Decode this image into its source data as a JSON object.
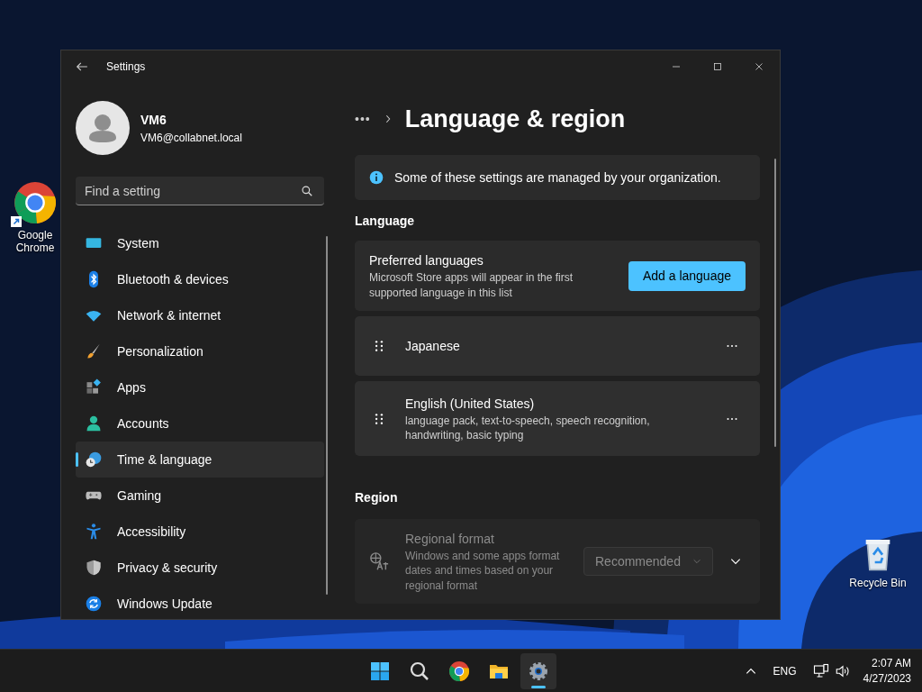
{
  "desktop_icons": [
    {
      "label": "Google Chrome",
      "kind": "chrome"
    },
    {
      "label": "Recycle Bin",
      "kind": "recycle"
    }
  ],
  "window": {
    "title": "Settings",
    "user": {
      "name": "VM6",
      "email": "VM6@collabnet.local"
    },
    "search": {
      "placeholder": "Find a setting"
    },
    "sidebar": {
      "items": [
        {
          "label": "System",
          "selected": false
        },
        {
          "label": "Bluetooth & devices",
          "selected": false
        },
        {
          "label": "Network & internet",
          "selected": false
        },
        {
          "label": "Personalization",
          "selected": false
        },
        {
          "label": "Apps",
          "selected": false
        },
        {
          "label": "Accounts",
          "selected": false
        },
        {
          "label": "Time & language",
          "selected": true
        },
        {
          "label": "Gaming",
          "selected": false
        },
        {
          "label": "Accessibility",
          "selected": false
        },
        {
          "label": "Privacy & security",
          "selected": false
        },
        {
          "label": "Windows Update",
          "selected": false
        }
      ]
    },
    "page": {
      "breadcrumb_more": "•••",
      "title": "Language & region",
      "notice": "Some of these settings are managed by your organization.",
      "language": {
        "heading": "Language",
        "preferred": {
          "title": "Preferred languages",
          "description": "Microsoft Store apps will appear in the first supported language in this list",
          "button": "Add a language"
        },
        "languages": [
          {
            "name": "Japanese"
          },
          {
            "name": "English (United States)",
            "detail": "language pack, text-to-speech, speech recognition, handwriting, basic typing"
          }
        ]
      },
      "region": {
        "heading": "Region",
        "regional_format": {
          "title": "Regional format",
          "description": "Windows and some apps format dates and times based on your regional format",
          "value": "Recommended",
          "disabled": true,
          "expanded": false
        }
      }
    }
  },
  "taskbar": {
    "apps": [
      {
        "kind": "start",
        "selected": false
      },
      {
        "kind": "search",
        "selected": false
      },
      {
        "kind": "chrome",
        "selected": false
      },
      {
        "kind": "folder",
        "selected": false
      },
      {
        "kind": "settings",
        "selected": true
      }
    ],
    "language": "ENG",
    "time": "2:07 AM",
    "date": "4/27/2023"
  }
}
